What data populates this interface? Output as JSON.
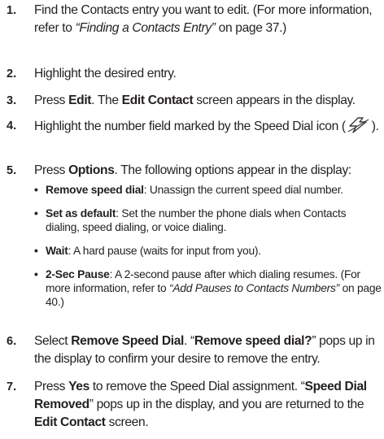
{
  "steps": [
    {
      "num": "1.",
      "p1": "Find the Contacts entry you want to edit. (For more information, refer to ",
      "link": "“Finding a Contacts Entry”",
      "p2": " on page 37.)"
    },
    {
      "num": "2.",
      "p1": "Highlight the desired entry."
    },
    {
      "num": "3.",
      "p1": "Press ",
      "b1": "Edit",
      "p2": ". The ",
      "b2": "Edit Contact",
      "p3": " screen appears in the display."
    },
    {
      "num": "4.",
      "p1": "Highlight the number field marked by the Speed Dial icon (",
      "p2": ")."
    },
    {
      "num": "5.",
      "p1": "Press ",
      "b1": "Options",
      "p2": ". The following options appear in the display:",
      "options": [
        {
          "term": "Remove speed dial",
          "desc": ": Unassign the current speed dial number."
        },
        {
          "term": "Set as default",
          "desc": ": Set the number the phone dials when Contacts dialing, speed dialing, or voice dialing."
        },
        {
          "term": "Wait",
          "desc": ": A hard pause (waits for input from you)."
        },
        {
          "term": "2-Sec Pause",
          "desc": ": A 2-second pause after which dialing resumes. (For more information, refer to ",
          "link": "“Add Pauses to Contacts Numbers”",
          "tail": " on page 40.)"
        }
      ]
    },
    {
      "num": "6.",
      "p1": "Select ",
      "b1": "Remove Speed Dial",
      "p2": ". “",
      "b2": "Remove speed dial?",
      "p3": "” pops up in the display to confirm your desire to remove the entry."
    },
    {
      "num": "7.",
      "p1": "Press ",
      "b1": "Yes",
      "p2": " to remove the Speed Dial assignment. “",
      "b2": "Speed Dial Removed",
      "p3": "” pops up in the display, and you are returned to the ",
      "b3": "Edit Contact",
      "p4": " screen."
    }
  ],
  "icons": {
    "speed_dial": "speed-dial-icon"
  },
  "colors": {
    "text": "#231f20",
    "icon": "#3a3a3a"
  }
}
